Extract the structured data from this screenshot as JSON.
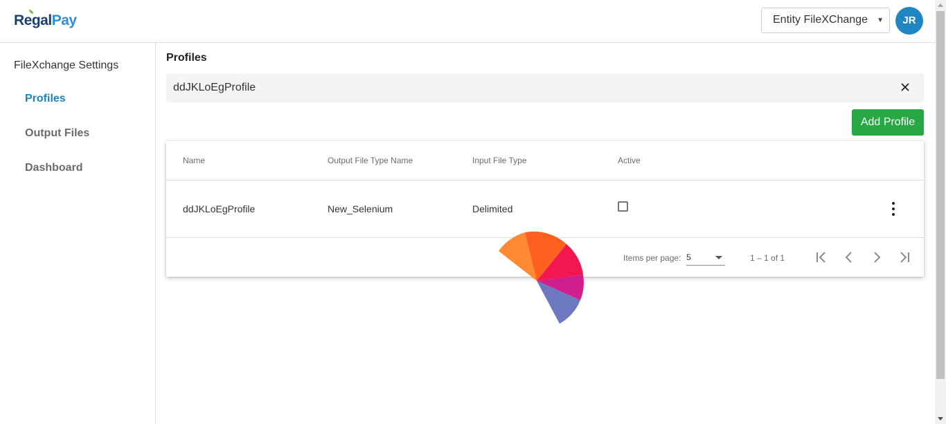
{
  "header": {
    "logo_regal": "Regal",
    "logo_pay": "Pay",
    "entity_select_value": "Entity FileXChange",
    "avatar_initials": "JR"
  },
  "sidebar": {
    "title": "FileXchange Settings",
    "items": [
      {
        "label": "Profiles",
        "active": true
      },
      {
        "label": "Output Files",
        "active": false
      },
      {
        "label": "Dashboard",
        "active": false
      }
    ]
  },
  "main": {
    "title": "Profiles",
    "search_value": "ddJKLoEgProfile",
    "add_button_label": "Add Profile",
    "table": {
      "columns": [
        "Name",
        "Output File Type Name",
        "Input File Type",
        "Active"
      ],
      "rows": [
        {
          "name": "ddJKLoEgProfile",
          "output_file_type": "New_Selenium",
          "input_file_type": "Delimited",
          "active": false
        }
      ]
    },
    "paginator": {
      "items_per_page_label": "Items per page:",
      "items_per_page_value": "5",
      "range_label": "1 – 1 of 1"
    }
  },
  "colors": {
    "accent": "#1a86c0",
    "add_button": "#28a745",
    "avatar": "#1f86c2",
    "spinner": [
      "#ff8a33",
      "#ff5f1f",
      "#f4174f",
      "#d01e8c",
      "#6c79c0"
    ]
  },
  "icons": {
    "clear": "close-icon",
    "row_menu": "more-vert-icon",
    "first": "first-page-icon",
    "prev": "chevron-left-icon",
    "next": "chevron-right-icon",
    "last": "last-page-icon"
  }
}
